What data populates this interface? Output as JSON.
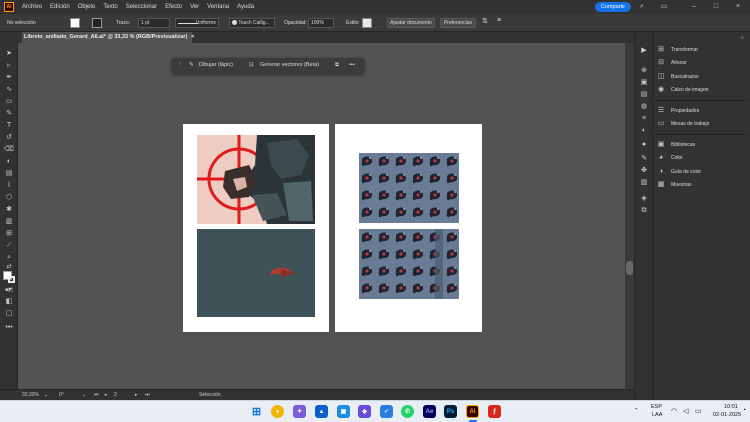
{
  "app": {
    "logo": "Ai"
  },
  "menu": [
    "Archivo",
    "Edición",
    "Objeto",
    "Texto",
    "Seleccionar",
    "Efecto",
    "Ver",
    "Ventana",
    "Ayuda"
  ],
  "share_label": "Compartir",
  "control": {
    "selection": "No selección",
    "stroke_label": "Trazo:",
    "stroke_value": "1 pt",
    "stroke_profile": "Uniforme",
    "brush": "Touch Callig...",
    "opacity_label": "Opacidad:",
    "opacity_value": "100%",
    "style_label": "Estilo:",
    "adjust_document": "Ajustar documento",
    "preferences": "Preferencias"
  },
  "doc_tab": {
    "title": "Libreto_anillado_Gerard_A6.ai* @ 33,33 % (RGB/Previsualizar)",
    "close": "×"
  },
  "context_bar": {
    "draw_label": "Dibujar (lápiz)",
    "vectors_label": "Generar vectores (Beta)",
    "more": "•••"
  },
  "right_panel": {
    "group1": [
      "Transformar",
      "Alinear",
      "Buscatrazos",
      "Calco de imagen"
    ],
    "group2": [
      "Propiedades",
      "Mesas de trabajo"
    ],
    "group3": [
      "Bibliotecas",
      "Color",
      "Guía de color",
      "Muestras"
    ]
  },
  "status": {
    "zoom": "33,33%",
    "angle": "0°",
    "artboard_num": "2",
    "tool": "Selección"
  },
  "taskbar": {
    "lang1": "ESP",
    "lang2": "LAA",
    "time": "10:01",
    "date": "02-01-2025"
  },
  "colors": {
    "accent": "#1473e6",
    "ui_dark": "#323232",
    "canvas": "#535353",
    "crosshair": "#e01b1b",
    "pattern_bg": "#6a7c95",
    "cover_bg": "#3f5257"
  }
}
